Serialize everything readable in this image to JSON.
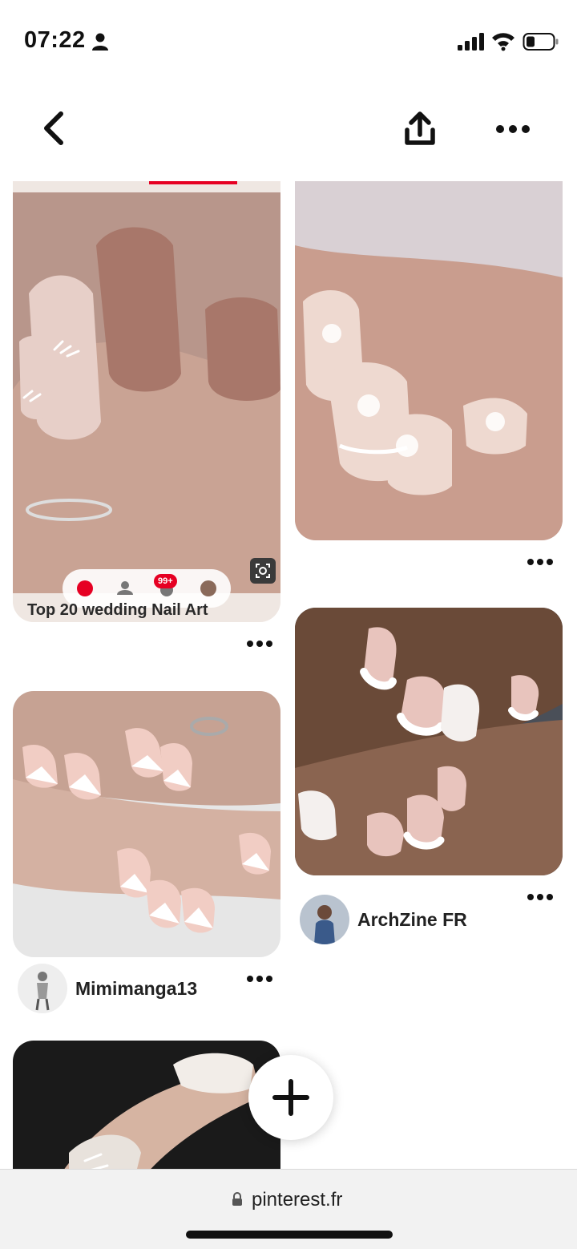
{
  "status_bar": {
    "time": "07:22",
    "icons": [
      "person-icon",
      "signal-icon",
      "wifi-icon",
      "battery-icon"
    ]
  },
  "nav": {
    "icons": [
      "back-icon",
      "share-icon",
      "more-icon"
    ]
  },
  "pins": [
    {
      "caption": "Top 20 wedding Nail Art",
      "notification_badge": "99+"
    },
    {
      "author": ""
    },
    {
      "author": "ArchZine FR"
    },
    {
      "author": "Mimimanga13"
    },
    {
      "author": ""
    }
  ],
  "fab": {
    "icon": "plus-icon"
  },
  "url_bar": {
    "url": "pinterest.fr"
  },
  "colors": {
    "brand": "#e60023",
    "background": "#ffffff",
    "url_bar_bg": "#f2f2f2"
  }
}
